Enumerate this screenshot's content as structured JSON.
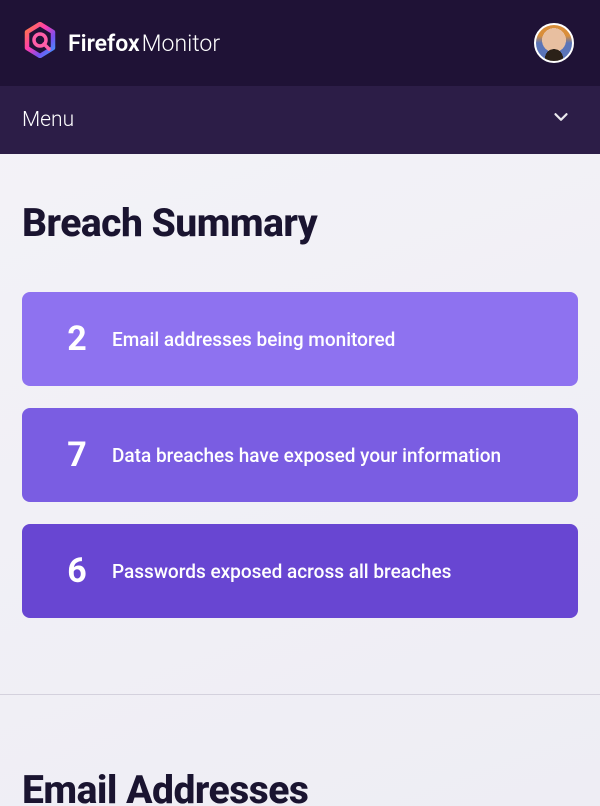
{
  "header": {
    "brand_bold": "Firefox",
    "brand_light": "Monitor"
  },
  "menu": {
    "label": "Menu"
  },
  "summary": {
    "title": "Breach Summary",
    "cards": [
      {
        "count": "2",
        "label": "Email addresses being monitored"
      },
      {
        "count": "7",
        "label": "Data breaches have exposed your information"
      },
      {
        "count": "6",
        "label": "Passwords exposed across all breaches"
      }
    ]
  },
  "emails": {
    "title": "Email Addresses"
  }
}
